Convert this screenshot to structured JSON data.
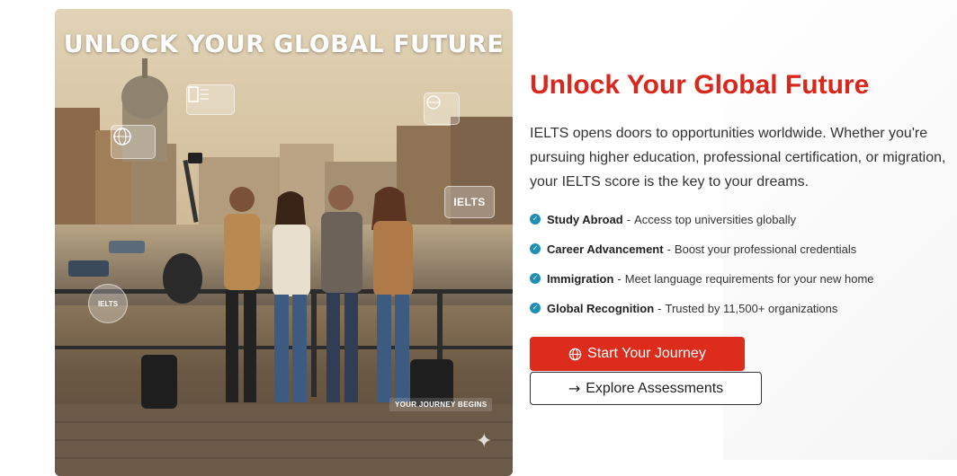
{
  "hero": {
    "overlay_title": "UNLOCK YOUR GLOBAL FUTURE",
    "badge_ielts": "IELTS",
    "badge_ielts_small": "IELTS",
    "caption": "YOUR JOURNEY BEGINS"
  },
  "content": {
    "headline": "Unlock Your Global Future",
    "intro_lines": [
      "IELTS opens doors to opportunities worldwide. Whether you're",
      "pursuing higher education, professional certification, or migration,",
      "your IELTS score is the key to your dreams."
    ],
    "benefits": [
      {
        "title": "Study Abroad",
        "text": "Access top universities globally"
      },
      {
        "title": "Career Advancement",
        "text": "Boost your professional credentials"
      },
      {
        "title": "Immigration",
        "text": "Meet language requirements for your new home"
      },
      {
        "title": "Global Recognition",
        "text": "Trusted by 11,500+ organizations"
      }
    ],
    "benefit_separator": "-",
    "check_icon": "check-circle-icon",
    "primary_button": {
      "label": "Start Your Journey",
      "icon": "globe-icon"
    },
    "secondary_button": {
      "label": "Explore Assessments",
      "icon": "arrow-right-icon"
    }
  },
  "colors": {
    "accent_red": "#dd2c1c",
    "headline_red": "#d9271c",
    "check_blue": "#1f8fb3"
  }
}
